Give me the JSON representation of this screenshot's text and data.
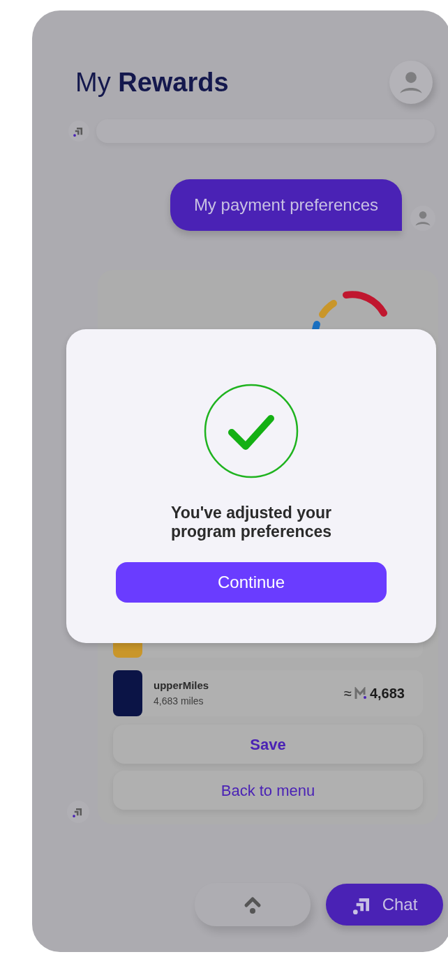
{
  "header": {
    "title": "My **Rewards**"
  },
  "chat": {
    "user_message": "My payment preferences"
  },
  "programs": [
    {
      "color": "#c9962a"
    },
    {
      "color": "#0b1446",
      "name": "upperMiles",
      "miles": "4,683 miles",
      "approx": "≈",
      "value": "4,683"
    }
  ],
  "actions": {
    "save": "Save",
    "back": "Back to menu"
  },
  "dialog": {
    "message": "You've adjusted your program preferences",
    "button": "Continue"
  },
  "bottom_bar": {
    "chat_button": "Chat"
  }
}
